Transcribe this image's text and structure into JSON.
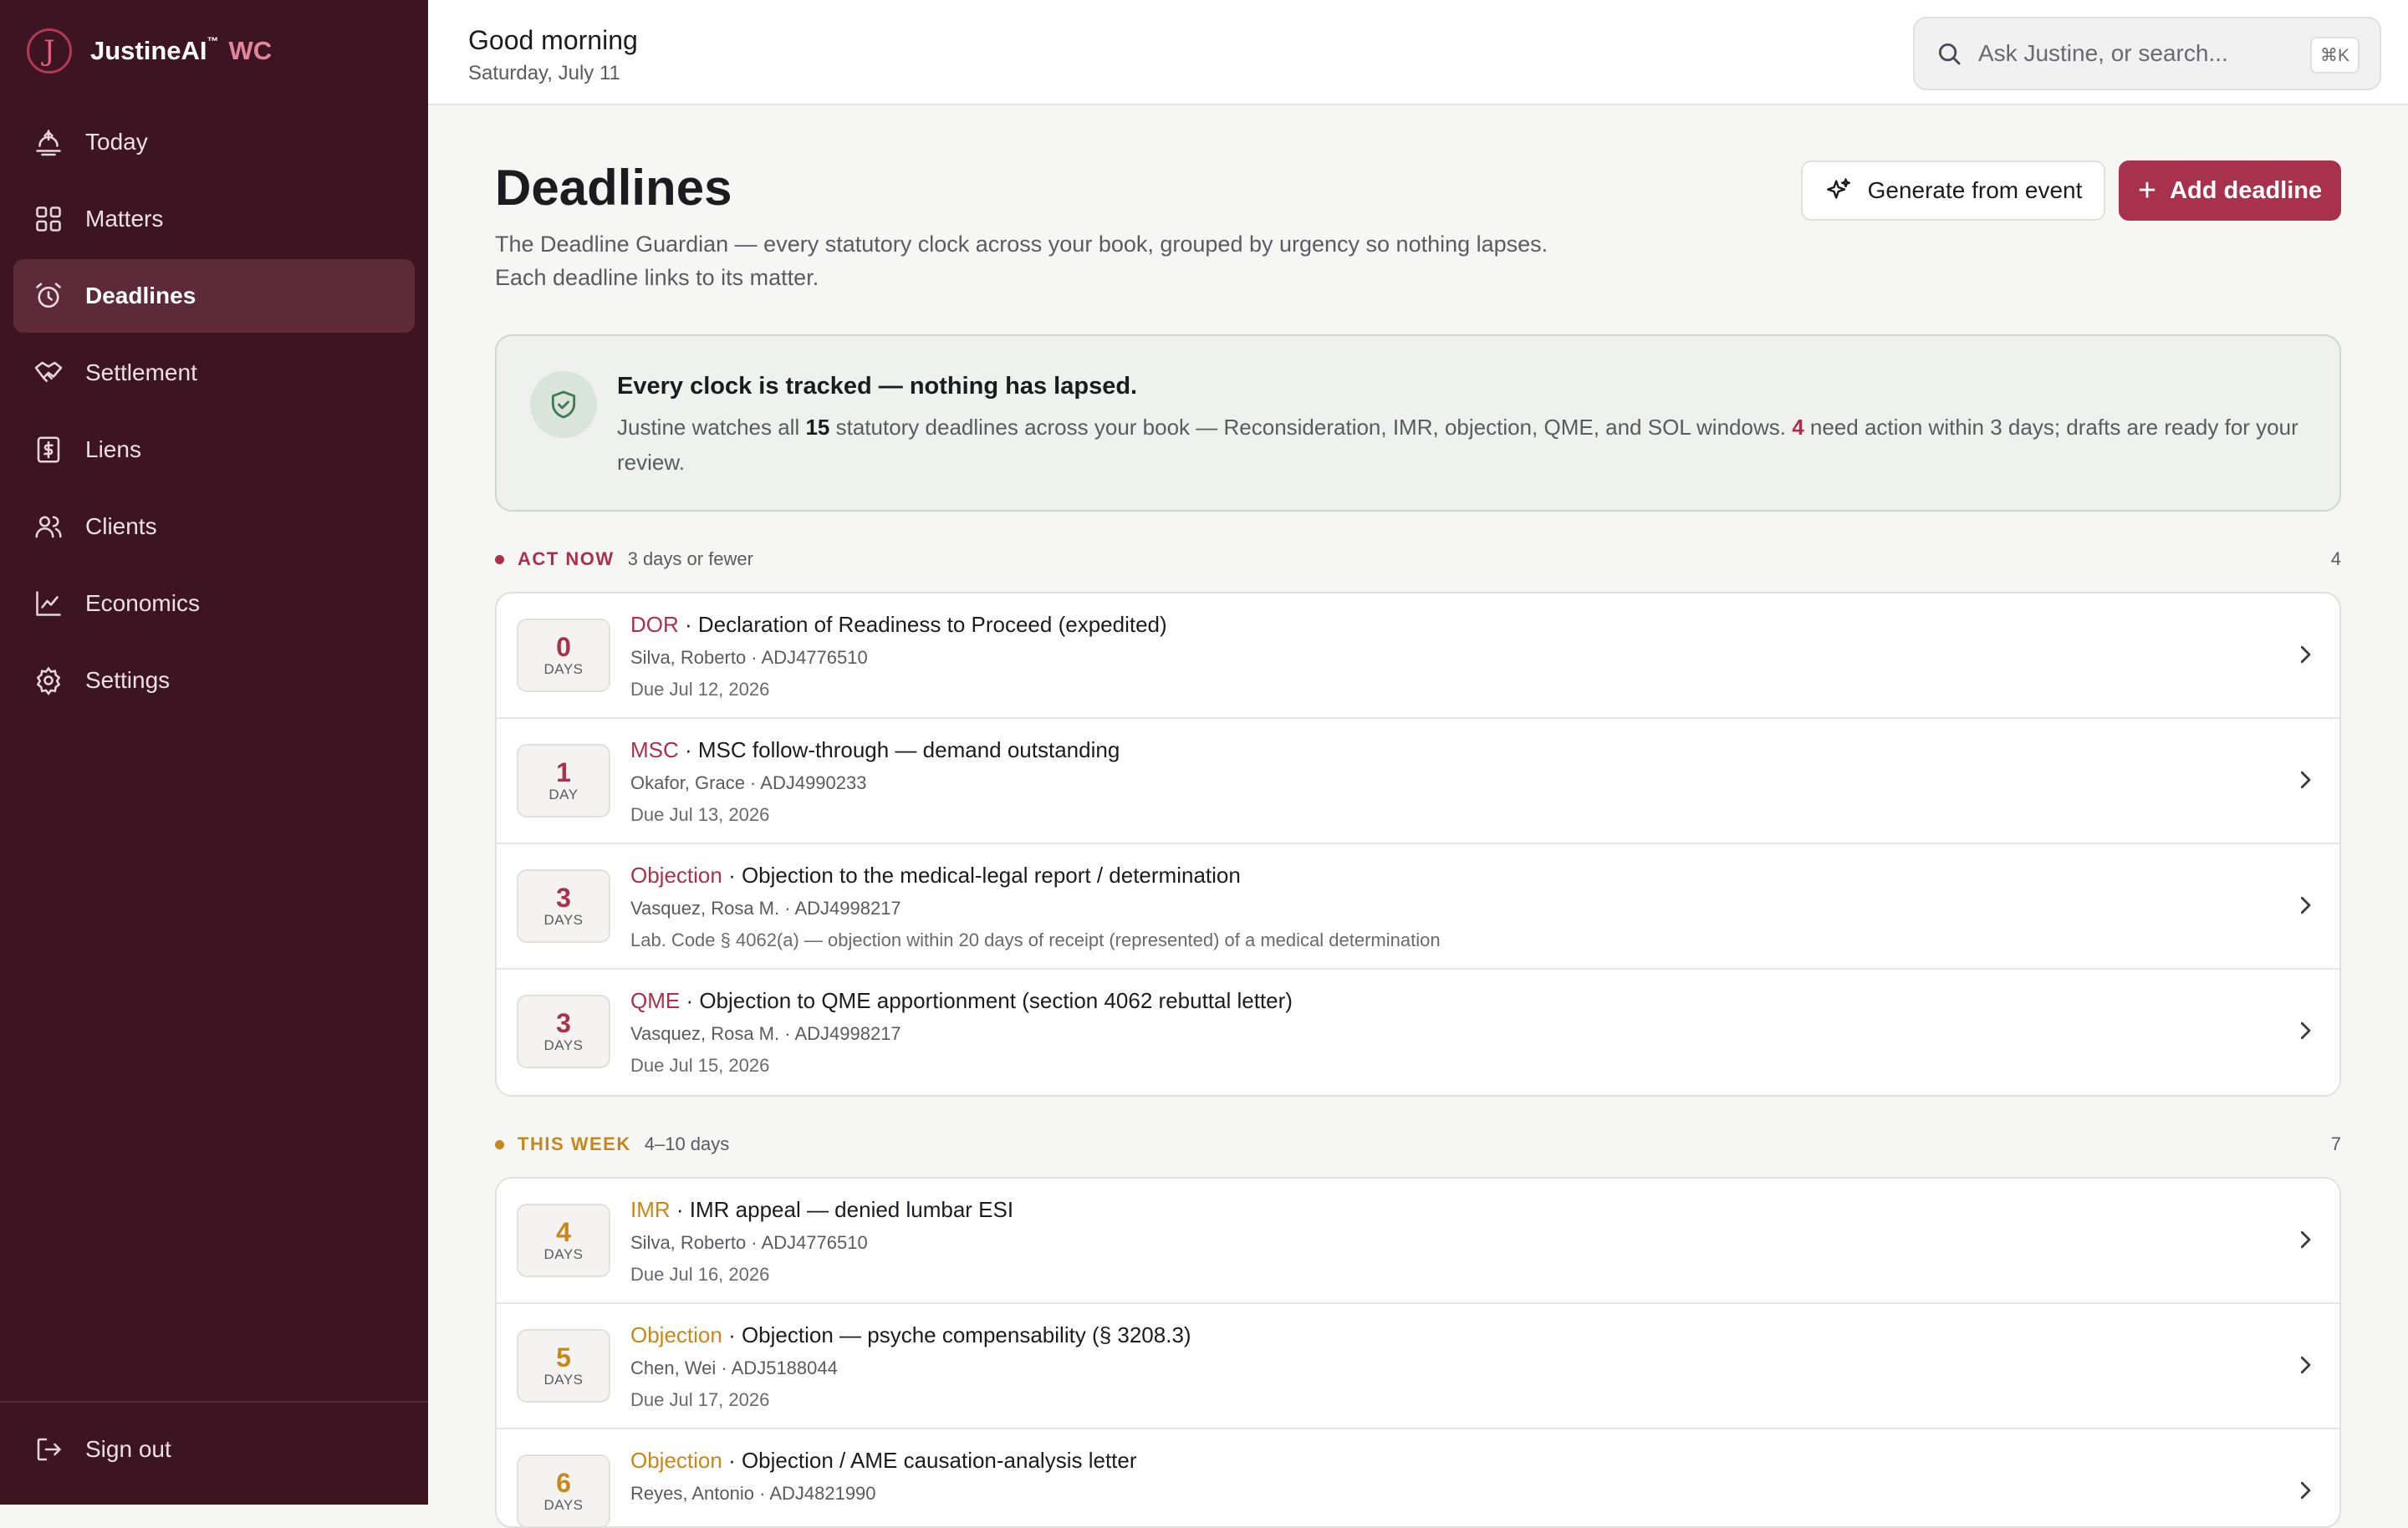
{
  "app": {
    "brand_name": "JustineAI",
    "brand_tm": "™",
    "brand_suffix": "WC",
    "logo_letter": "J"
  },
  "sidebar": {
    "items": [
      {
        "label": "Today",
        "icon": "today-icon",
        "active": false
      },
      {
        "label": "Matters",
        "icon": "grid-icon",
        "active": false
      },
      {
        "label": "Deadlines",
        "icon": "alarm-clock-icon",
        "active": true
      },
      {
        "label": "Settlement",
        "icon": "handshake-icon",
        "active": false
      },
      {
        "label": "Liens",
        "icon": "dollar-document-icon",
        "active": false
      },
      {
        "label": "Clients",
        "icon": "users-icon",
        "active": false
      },
      {
        "label": "Economics",
        "icon": "line-chart-icon",
        "active": false
      },
      {
        "label": "Settings",
        "icon": "gear-icon",
        "active": false
      }
    ],
    "signout_label": "Sign out"
  },
  "header": {
    "greeting": "Good morning",
    "date": "Saturday, July 11",
    "search_placeholder": "Ask Justine, or search...",
    "search_shortcut": "⌘K"
  },
  "page": {
    "title": "Deadlines",
    "description_line1": "The Deadline Guardian — every statutory clock across your book, grouped by urgency so nothing lapses.",
    "description_line2": "Each deadline links to its matter.",
    "generate_button": "Generate from event",
    "add_button": "Add deadline"
  },
  "banner": {
    "title": "Every clock is tracked — nothing has lapsed.",
    "text_1": "Justine watches all ",
    "count_total": "15",
    "text_2": " statutory deadlines across your book — Reconsideration, IMR, objection, QME, and SOL windows. ",
    "count_urgent": "4",
    "text_3": " need action within 3 days; drafts are ready for your review."
  },
  "sections": {
    "act_now": {
      "label": "ACT NOW",
      "sub": "3 days or fewer",
      "count": "4",
      "color": "#a8324d"
    },
    "this_week": {
      "label": "THIS WEEK",
      "sub": "4–10 days",
      "count": "7",
      "color": "#c7881a"
    }
  },
  "act_now_rows": [
    {
      "days": "0",
      "unit": "DAYS",
      "type": "DOR",
      "title": "Declaration of Readiness to Proceed (expedited)",
      "meta": "Silva, Roberto · ADJ4776510",
      "due": "Due Jul 12, 2026"
    },
    {
      "days": "1",
      "unit": "DAY",
      "type": "MSC",
      "title": "MSC follow-through — demand outstanding",
      "meta": "Okafor, Grace · ADJ4990233",
      "due": "Due Jul 13, 2026"
    },
    {
      "days": "3",
      "unit": "DAYS",
      "type": "Objection",
      "title": "Objection to the medical-legal report / determination",
      "meta": "Vasquez, Rosa M. · ADJ4998217",
      "due": "Lab. Code § 4062(a) — objection within 20 days of receipt (represented) of a medical determination"
    },
    {
      "days": "3",
      "unit": "DAYS",
      "type": "QME",
      "title": "Objection to QME apportionment (section 4062 rebuttal letter)",
      "meta": "Vasquez, Rosa M. · ADJ4998217",
      "due": "Due Jul 15, 2026"
    }
  ],
  "this_week_rows": [
    {
      "days": "4",
      "unit": "DAYS",
      "type": "IMR",
      "title": "IMR appeal — denied lumbar ESI",
      "meta": "Silva, Roberto · ADJ4776510",
      "due": "Due Jul 16, 2026"
    },
    {
      "days": "5",
      "unit": "DAYS",
      "type": "Objection",
      "title": "Objection — psyche compensability (§ 3208.3)",
      "meta": "Chen, Wei · ADJ5188044",
      "due": "Due Jul 17, 2026"
    },
    {
      "days": "6",
      "unit": "DAYS",
      "type": "Objection",
      "title": "Objection / AME causation-analysis letter",
      "meta": "Reyes, Antonio · ADJ4821990",
      "due": ""
    }
  ],
  "colors": {
    "sidebar_bg": "#3d1422",
    "accent": "#a8324d",
    "amber": "#c7881a",
    "banner_bg": "#eef1ed"
  }
}
